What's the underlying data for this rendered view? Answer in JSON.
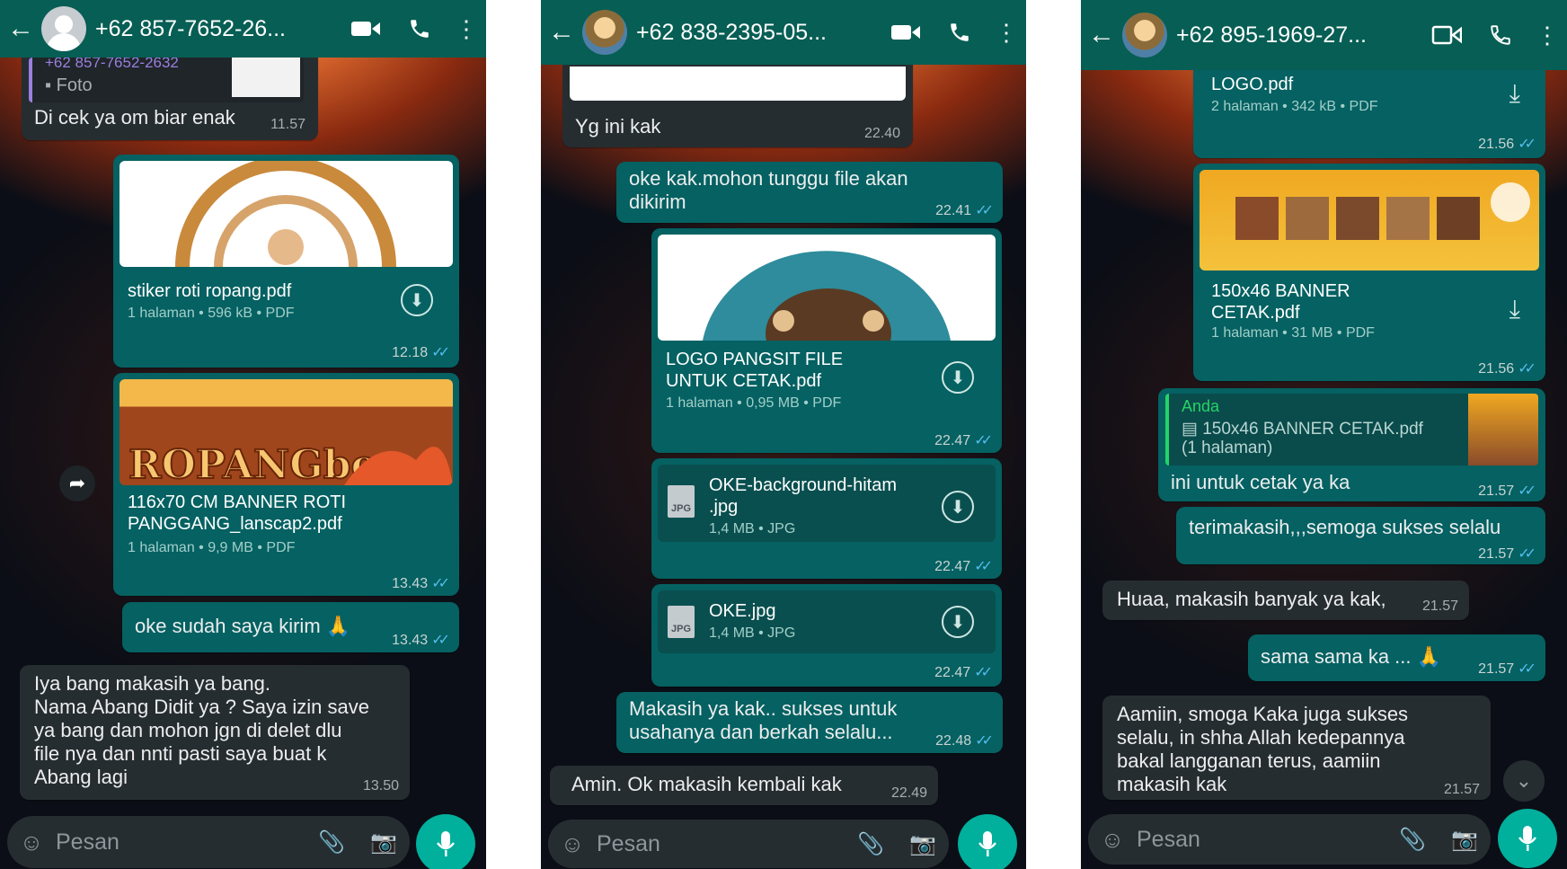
{
  "common": {
    "input_placeholder": "Pesan"
  },
  "chat1": {
    "contact": "+62 857-7652-26...",
    "quoted_number": "+62 857-7652-2632",
    "quoted_type": "Foto",
    "m1_text": "Di cek ya om biar enak",
    "m1_time": "11.57",
    "f1_name": "stiker roti ropang.pdf",
    "f1_meta": "1 halaman • 596 kB • PDF",
    "f1_time": "12.18",
    "f2_name": "116x70 CM BANNER ROTI\nPANGGANG_lanscap2.pdf",
    "f2_meta": "1 halaman • 9,9 MB • PDF",
    "f2_time": "13.43",
    "m2_text": "oke sudah saya kirim 🙏",
    "m2_time": "13.43",
    "m3_text": "Iya bang makasih ya bang.\nNama Abang Didit ya ? Saya izin save\nya bang dan mohon jgn di delet dlu\nfile nya dan nnti pasti saya buat k\nAbang lagi",
    "m3_time": "13.50"
  },
  "chat2": {
    "contact": "+62 838-2395-05...",
    "m1_text": "Yg ini kak",
    "m1_time": "22.40",
    "m2_text": "oke kak.mohon tunggu file akan\ndikirim",
    "m2_time": "22.41",
    "f1_name": "LOGO PANGSIT FILE\nUNTUK CETAK.pdf",
    "f1_meta": "1 halaman • 0,95 MB • PDF",
    "f1_time": "22.47",
    "f2_name": "OKE-background-hitam\n.jpg",
    "f2_meta": "1,4 MB • JPG",
    "f2_time": "22.47",
    "f3_name": "OKE.jpg",
    "f3_meta": "1,4 MB • JPG",
    "f3_time": "22.47",
    "jpg_label": "JPG",
    "m3_text": "Makasih ya kak.. sukses untuk\nusahanya dan berkah selalu...",
    "m3_time": "22.48",
    "m4_text": "Amin. Ok makasih kembali kak",
    "m4_time": "22.49"
  },
  "chat3": {
    "contact": "+62 895-1969-27...",
    "f1_name": "LOGO.pdf",
    "f1_meta": "2 halaman • 342 kB • PDF",
    "f1_time": "21.56",
    "f2_name": "150x46 BANNER\nCETAK.pdf",
    "f2_meta": "1 halaman • 31 MB • PDF",
    "f2_time": "21.56",
    "reply_author": "Anda",
    "reply_file": "150x46 BANNER CETAK.pdf",
    "reply_pages": "(1 halaman)",
    "m1_text": "ini untuk cetak ya ka",
    "m1_time": "21.57",
    "m2_text": "terimakasih,,,semoga sukses selalu",
    "m2_time": "21.57",
    "m3_text": "Huaa, makasih banyak ya kak,",
    "m3_time": "21.57",
    "m4_text": "sama sama ka ... 🙏",
    "m4_time": "21.57",
    "m5_text": "Aamiin, smoga Kaka juga sukses\nselalu, in shha Allah kedepannya\nbakal langganan terus, aamiin\nmakasih kak",
    "m5_time": "21.57"
  },
  "colors": {
    "header": "#075e54",
    "outgoing": "#056162",
    "incoming": "#262d31",
    "tick": "#53bdeb",
    "mic": "#00af9c"
  }
}
